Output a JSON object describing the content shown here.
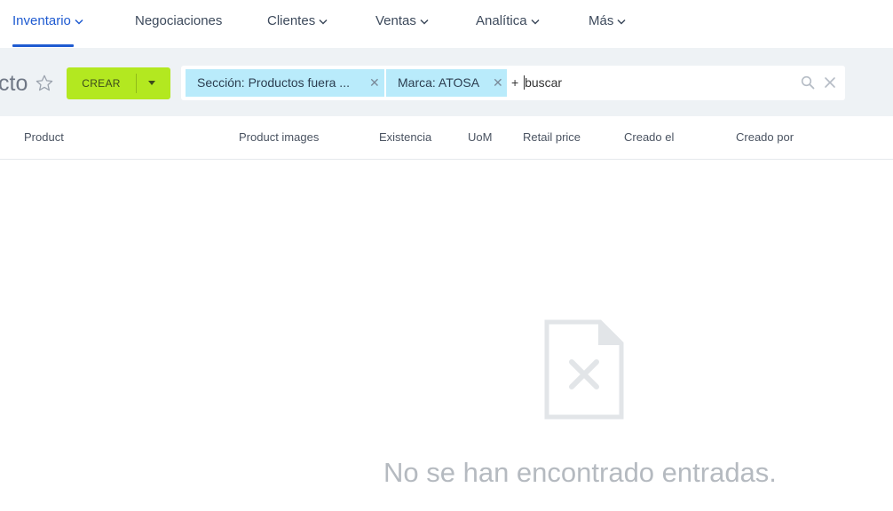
{
  "nav": {
    "items": [
      {
        "label": "Inventario",
        "active": true
      },
      {
        "label": "Negociaciones",
        "active": false
      },
      {
        "label": "Clientes",
        "active": false
      },
      {
        "label": "Ventas",
        "active": false
      },
      {
        "label": "Analítica",
        "active": false
      },
      {
        "label": "Más",
        "active": false
      }
    ]
  },
  "control_panel": {
    "title_fragment": "cto",
    "create_label": "CREAR",
    "search": {
      "facets": [
        {
          "label": "Sección: Productos fuera ..."
        },
        {
          "label": "Marca: ATOSA"
        }
      ],
      "input_prefix": "+ ",
      "input_value": "buscar"
    }
  },
  "list": {
    "columns": [
      "Product",
      "Product images",
      "Existencia",
      "UoM",
      "Retail price",
      "Creado el",
      "Creado por"
    ]
  },
  "empty_state": {
    "message": "No se han encontrado entradas."
  },
  "colors": {
    "accent": "#1f5bd1",
    "create_button": "#b3e820",
    "facet_bg": "#b9ebfb",
    "panel_bg": "#eef2f5"
  }
}
